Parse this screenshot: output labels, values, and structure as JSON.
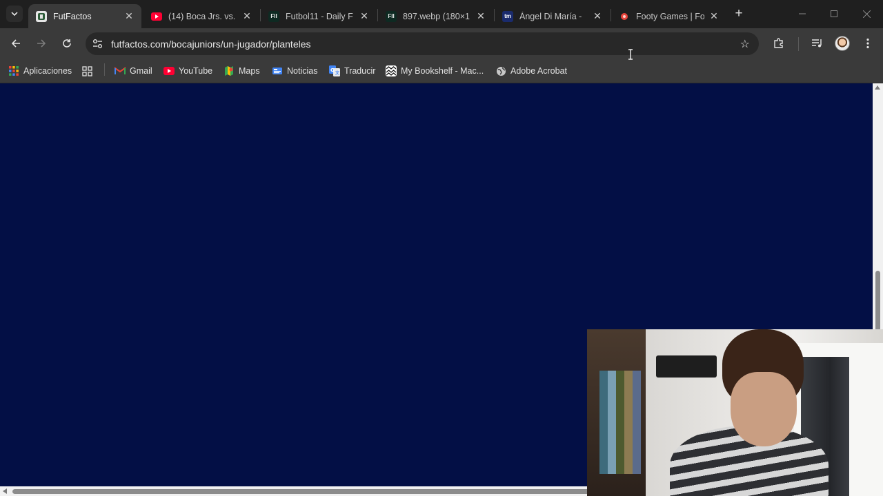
{
  "tabs": [
    {
      "title": "FutFactos",
      "active": true,
      "favicon": "futfactos-icon",
      "color": "#2e5d3a"
    },
    {
      "title": "(14) Boca Jrs. vs. S",
      "active": false,
      "favicon": "youtube-icon",
      "color": "#ff0033"
    },
    {
      "title": "Futbol11 - Daily F",
      "active": false,
      "favicon": "futbol11-icon",
      "color": "#0e2a22"
    },
    {
      "title": "897.webp (180×1",
      "active": false,
      "favicon": "futbol11-icon",
      "color": "#0e2a22"
    },
    {
      "title": "Ángel Di María - ",
      "active": false,
      "favicon": "transfermarkt-icon",
      "color": "#1a2b6d"
    },
    {
      "title": "Footy Games | Fo",
      "active": false,
      "favicon": "footy-games-icon",
      "color": "#e8453c"
    }
  ],
  "toolbar": {
    "url": "futfactos.com/bocajuniors/un-jugador/planteles"
  },
  "bookmarks": [
    {
      "label": "Aplicaciones",
      "icon": "apps-grid-icon"
    },
    {
      "label": "",
      "icon": "tab-groups-icon"
    },
    {
      "label": "Gmail",
      "icon": "gmail-icon"
    },
    {
      "label": "YouTube",
      "icon": "youtube-icon"
    },
    {
      "label": "Maps",
      "icon": "maps-icon"
    },
    {
      "label": "Noticias",
      "icon": "news-icon"
    },
    {
      "label": "Traducir",
      "icon": "translate-icon"
    },
    {
      "label": "My Bookshelf - Mac...",
      "icon": "bookshelf-icon"
    },
    {
      "label": "Adobe Acrobat",
      "icon": "globe-icon"
    }
  ],
  "colors": {
    "page_background": "#030f45",
    "toolbar": "#3a3a3a",
    "tabstrip": "#1f1f1f"
  },
  "webcam": {
    "present": true
  }
}
